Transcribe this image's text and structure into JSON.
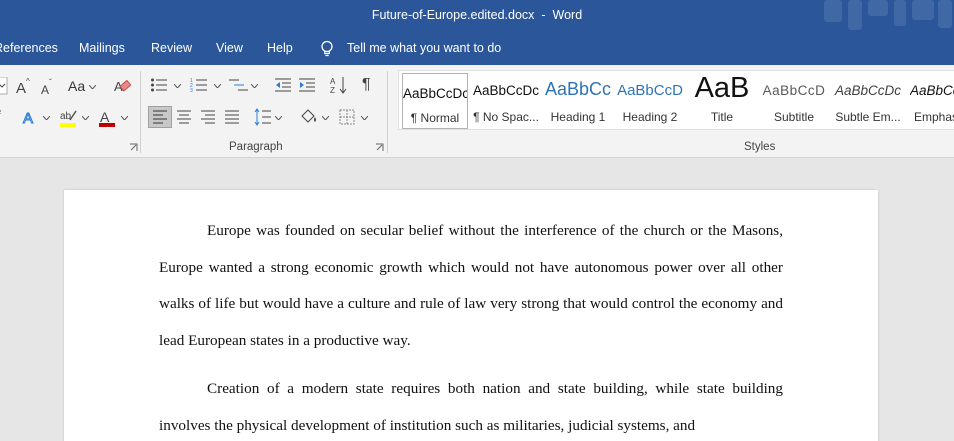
{
  "window": {
    "document_name": "Future-of-Europe.edited.docx",
    "separator": "-",
    "app_name": "Word"
  },
  "tabs": {
    "references": "References",
    "mailings": "Mailings",
    "review": "Review",
    "view": "View",
    "help": "Help",
    "tell_me": "Tell me what you want to do"
  },
  "ribbon": {
    "font_group": {
      "change_case_label": "Aa",
      "font_color": "#c00000",
      "highlight_color": "#ffff00"
    },
    "paragraph_group": {
      "label": "Paragraph"
    },
    "styles_group": {
      "label": "Styles",
      "items": [
        {
          "preview": "AaBbCcDc",
          "name": "¶ Normal",
          "selected": true
        },
        {
          "preview": "AaBbCcDc",
          "name": "¶ No Spac..."
        },
        {
          "preview": "AaBbCc",
          "name": "Heading 1",
          "color": "#2e74b5"
        },
        {
          "preview": "AaBbCcD",
          "name": "Heading 2",
          "color": "#2e74b5"
        },
        {
          "preview": "AaB",
          "name": "Title"
        },
        {
          "preview": "AaBbCcD",
          "name": "Subtitle",
          "color": "#595959"
        },
        {
          "preview": "AaBbCcDc",
          "name": "Subtle Em...",
          "italic": true
        },
        {
          "preview": "AaBbCcDc",
          "name": "Emphas",
          "italic": true
        }
      ]
    }
  },
  "document": {
    "paragraphs": [
      "Europe was founded on secular belief without the interference of the church or the Masons, Europe wanted a strong economic growth which would not have autonomous power over all other walks of life but would have a culture and rule of law very strong that would control the economy and lead European states in a productive way.",
      "Creation of a modern state requires both nation and state building, while state building involves the physical development of institution such as militaries, judicial systems, and"
    ]
  }
}
